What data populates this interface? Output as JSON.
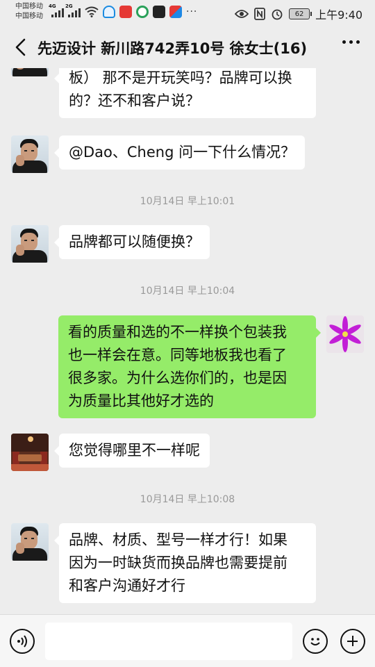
{
  "status_bar": {
    "carrier_1": "中国移动",
    "carrier_2": "中国移动",
    "net_1": "4G",
    "net_2": "2G",
    "battery": "62",
    "time": "上午9:40"
  },
  "header": {
    "title": "先迈设计 新川路742弄10号  徐女士(16)"
  },
  "messages": [
    {
      "side": "left",
      "avatar": "man-avatar",
      "lines": [
        "板） 那不是开玩笑吗？品牌可以换",
        "的？还不和客户说？"
      ]
    },
    {
      "side": "left",
      "avatar": "man-avatar",
      "lines": [
        "@Dao、Cheng  问一下什么情况？"
      ]
    },
    {
      "type": "time",
      "text": "10月14日 早上10:01"
    },
    {
      "side": "left",
      "avatar": "man-avatar",
      "lines": [
        "品牌都可以随便换？"
      ]
    },
    {
      "type": "time",
      "text": "10月14日 早上10:04"
    },
    {
      "side": "right",
      "avatar": "flower-avatar",
      "lines": [
        "看的质量和选的不一样换个包装我",
        "也一样会在意。同等地板我也看了",
        "很多家。为什么选你们的，也是因",
        "为质量比其他好才选的"
      ]
    },
    {
      "side": "left",
      "avatar": "room-avatar",
      "lines": [
        "您觉得哪里不一样呢"
      ]
    },
    {
      "type": "time",
      "text": "10月14日 早上10:08"
    },
    {
      "side": "left",
      "avatar": "man-avatar",
      "lines": [
        "品牌、材质、型号一样才行！如果",
        "因为一时缺货而换品牌也需要提前",
        "和客户沟通好才行"
      ]
    }
  ],
  "input": {
    "placeholder": ""
  },
  "colors": {
    "background": "#ededed",
    "bubble_self": "#95ec69",
    "bubble_other": "#ffffff",
    "timestamp": "#999999"
  },
  "icons": [
    "back-arrow-icon",
    "more-dots-icon",
    "voice-icon",
    "emoji-icon",
    "plus-icon",
    "eye-icon",
    "nfc-icon",
    "alarm-icon",
    "wifi-icon"
  ]
}
